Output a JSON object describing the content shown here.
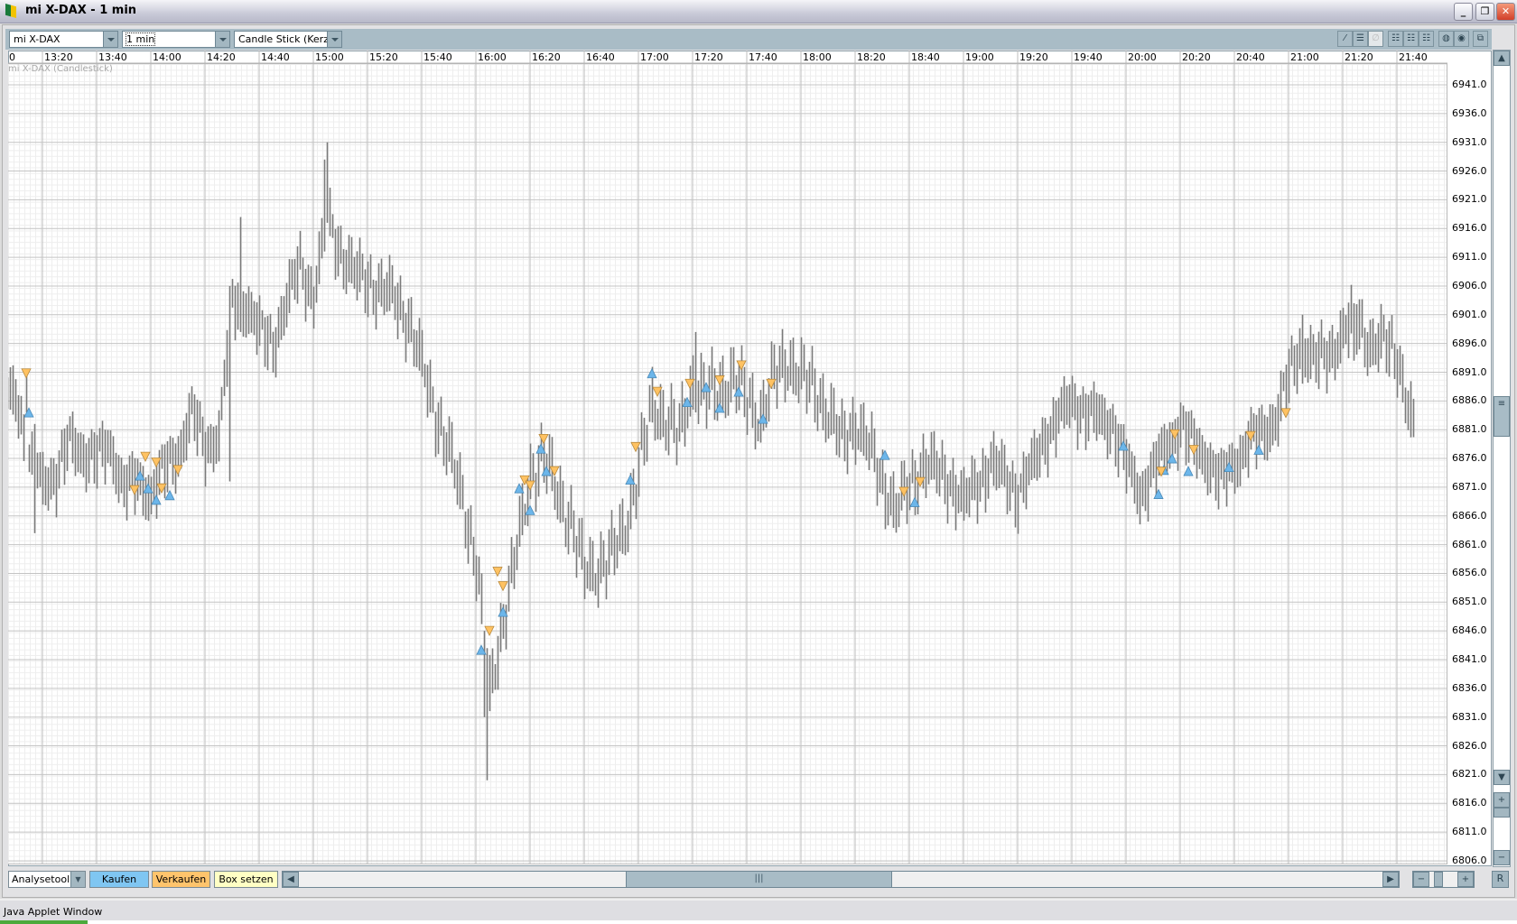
{
  "window": {
    "title": "mi X-DAX - 1 min",
    "minimize": "_",
    "restore": "❐",
    "close": "✕"
  },
  "toolbar": {
    "instrument": "mi X-DAX",
    "interval": "1 min",
    "chart_type": "Candle Stick (Kerzen",
    "icons": [
      "draw-line-icon",
      "horizontal-lines-icon",
      "delete-disabled-icon",
      "grid-1-icon",
      "grid-2-icon",
      "grid-3-icon",
      "indicator-1-icon",
      "indicator-2-icon",
      "detach-window-icon"
    ]
  },
  "chart_title": "mi X-DAX (Candlestick)",
  "bottom": {
    "tool_select": "Analysetool",
    "buy": "Kaufen",
    "sell": "Verkaufen",
    "box": "Box setzen",
    "reset": "R",
    "zoom_in": "+",
    "zoom_out": "−"
  },
  "status": "Java Applet Window",
  "colors": {
    "bar": "#7a7a7a",
    "buy": "#6cb6ea",
    "sell": "#ffc262"
  },
  "chart_data": {
    "type": "candlestick",
    "title": "mi X-DAX (Candlestick)",
    "x_tick_labels": [
      "0",
      "13:20",
      "13:40",
      "14:00",
      "14:20",
      "14:40",
      "15:00",
      "15:20",
      "15:40",
      "16:00",
      "16:20",
      "16:40",
      "17:00",
      "17:20",
      "17:40",
      "18:00",
      "18:20",
      "18:40",
      "19:00",
      "19:20",
      "19:40",
      "20:00",
      "20:20",
      "20:40",
      "21:00",
      "21:20",
      "21:40"
    ],
    "y_tick_labels": [
      "6941.0",
      "6936.0",
      "6931.0",
      "6926.0",
      "6921.0",
      "6916.0",
      "6911.0",
      "6906.0",
      "6901.0",
      "6896.0",
      "6891.0",
      "6886.0",
      "6881.0",
      "6876.0",
      "6871.0",
      "6866.0",
      "6861.0",
      "6856.0",
      "6851.0",
      "6846.0",
      "6841.0",
      "6836.0",
      "6831.0",
      "6826.0",
      "6821.0",
      "6816.0",
      "6811.0",
      "6806.0"
    ],
    "ylim": [
      6805.5,
      6944.8
    ],
    "xlim": [
      "13:07",
      "21:46"
    ],
    "interval_min": 1,
    "mid_anchor_start": "13:05",
    "mid_anchor_step_min": 5,
    "mid_anchors": [
      6886,
      6888,
      6875,
      6872,
      6873,
      6879,
      6877,
      6876,
      6878,
      6871,
      6872,
      6870,
      6874,
      6877,
      6884,
      6878,
      6880,
      6903,
      6903,
      6898,
      6896,
      6903,
      6910,
      6904,
      6918,
      6912,
      6908,
      6907,
      6905,
      6904,
      6900,
      6892,
      6884,
      6877,
      6869,
      6858,
      6835,
      6848,
      6860,
      6873,
      6876,
      6870,
      6865,
      6856,
      6857,
      6859,
      6864,
      6874,
      6885,
      6883,
      6880,
      6889,
      6887,
      6888,
      6890,
      6886,
      6883,
      6890,
      6893,
      6890,
      6888,
      6884,
      6879,
      6882,
      6878,
      6872,
      6867,
      6871,
      6875,
      6874,
      6872,
      6868,
      6872,
      6875,
      6873,
      6870,
      6874,
      6880,
      6883,
      6886,
      6884,
      6883,
      6882,
      6875,
      6870,
      6874,
      6878,
      6882,
      6878,
      6876,
      6872,
      6875,
      6879,
      6880,
      6883,
      6890,
      6896,
      6893,
      6894,
      6898,
      6900,
      6896,
      6896,
      6894,
      6883
    ],
    "extremes": [
      {
        "time": "13:14",
        "high": 6891,
        "low": 6884
      },
      {
        "time": "13:17",
        "high": 6882,
        "low": 6863
      },
      {
        "time": "14:29",
        "high": 6906,
        "low": 6872
      },
      {
        "time": "14:33",
        "high": 6918,
        "low": 6898
      },
      {
        "time": "15:04",
        "high": 6928,
        "low": 6912
      },
      {
        "time": "15:05",
        "high": 6931,
        "low": 6917
      },
      {
        "time": "16:03",
        "high": 6846,
        "low": 6831
      },
      {
        "time": "16:04",
        "high": 6843,
        "low": 6820
      },
      {
        "time": "17:21",
        "high": 6898,
        "low": 6884
      },
      {
        "time": "21:05",
        "high": 6901,
        "low": 6889
      },
      {
        "time": "21:24",
        "high": 6903,
        "low": 6893
      }
    ],
    "buy_signals": [
      [
        "13:15",
        6884
      ],
      [
        "13:56",
        6873
      ],
      [
        "13:59",
        6870.8
      ],
      [
        "14:02",
        6868.8
      ],
      [
        "14:07",
        6869.6
      ],
      [
        "16:02",
        6842.7
      ],
      [
        "16:10",
        6849.3
      ],
      [
        "16:16",
        6870.8
      ],
      [
        "16:20",
        6867
      ],
      [
        "16:24",
        6877.7
      ],
      [
        "16:26",
        6873.8
      ],
      [
        "16:57",
        6872.3
      ],
      [
        "17:05",
        6890.8
      ],
      [
        "17:18",
        6885.8
      ],
      [
        "17:25",
        6888.4
      ],
      [
        "17:30",
        6884.8
      ],
      [
        "17:37",
        6887.6
      ],
      [
        "17:46",
        6882.9
      ],
      [
        "18:31",
        6876.6
      ],
      [
        "18:42",
        6868.4
      ],
      [
        "19:59",
        6878.2
      ],
      [
        "20:12",
        6869.8
      ],
      [
        "20:14",
        6874
      ],
      [
        "20:17",
        6876
      ],
      [
        "20:23",
        6873.8
      ],
      [
        "20:38",
        6874.5
      ],
      [
        "20:49",
        6877.5
      ]
    ],
    "sell_signals": [
      [
        "13:14",
        6890.8
      ],
      [
        "13:54",
        6870.5
      ],
      [
        "13:58",
        6876.3
      ],
      [
        "14:02",
        6875.3
      ],
      [
        "14:04",
        6870.8
      ],
      [
        "14:10",
        6874
      ],
      [
        "16:05",
        6846
      ],
      [
        "16:08",
        6856.3
      ],
      [
        "16:10",
        6853.8
      ],
      [
        "16:18",
        6872.2
      ],
      [
        "16:20",
        6871.3
      ],
      [
        "16:25",
        6879.4
      ],
      [
        "16:29",
        6873.8
      ],
      [
        "16:59",
        6878
      ],
      [
        "17:07",
        6887.6
      ],
      [
        "17:19",
        6889
      ],
      [
        "17:30",
        6889.6
      ],
      [
        "17:38",
        6892.2
      ],
      [
        "17:49",
        6889
      ],
      [
        "18:38",
        6870.2
      ],
      [
        "18:44",
        6871.9
      ],
      [
        "20:13",
        6873.7
      ],
      [
        "20:18",
        6880.2
      ],
      [
        "20:25",
        6877.5
      ],
      [
        "20:46",
        6879.9
      ],
      [
        "20:59",
        6883.9
      ]
    ]
  }
}
